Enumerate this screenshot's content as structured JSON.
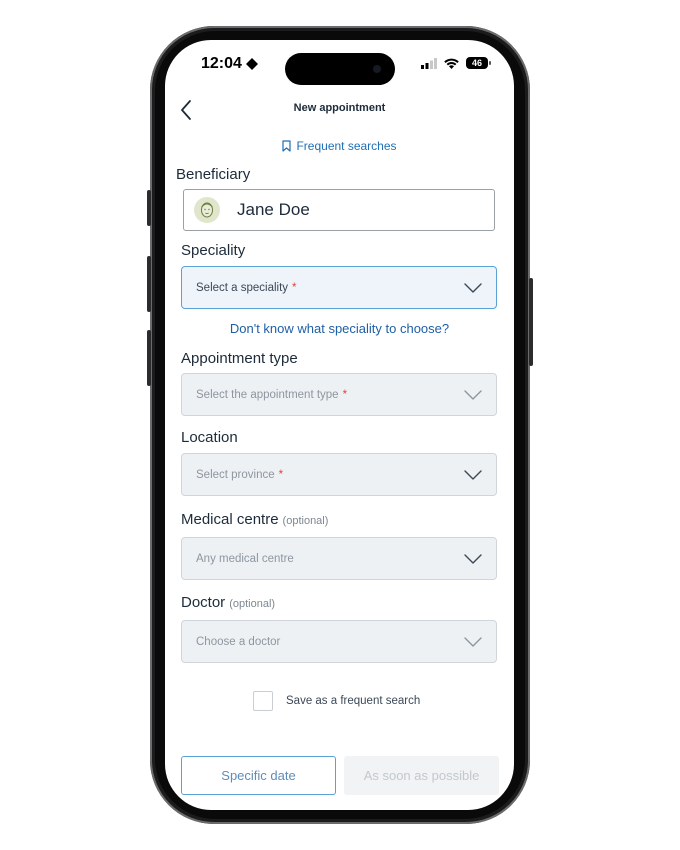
{
  "status_bar": {
    "time": "12:04",
    "battery": "46"
  },
  "header": {
    "title": "New appointment"
  },
  "frequent_searches_link": "Frequent searches",
  "beneficiary": {
    "label": "Beneficiary",
    "name": "Jane Doe"
  },
  "speciality": {
    "label": "Speciality",
    "placeholder": "Select a speciality",
    "required_mark": "*",
    "help_link": "Don't know what speciality to choose?"
  },
  "appointment_type": {
    "label": "Appointment type",
    "placeholder": "Select the appointment type",
    "required_mark": "*"
  },
  "location": {
    "label": "Location",
    "placeholder": "Select province",
    "required_mark": "*"
  },
  "medical_centre": {
    "label": "Medical centre",
    "optional": "(optional)",
    "placeholder": "Any medical centre"
  },
  "doctor": {
    "label": "Doctor",
    "optional": "(optional)",
    "placeholder": "Choose a doctor"
  },
  "save_frequent": {
    "label": "Save as a frequent search",
    "checked": false
  },
  "buttons": {
    "specific_date": "Specific date",
    "asap": "As soon as possible"
  },
  "colors": {
    "accent": "#1f6fb5",
    "required": "#e0433c",
    "active_border": "#5aa2d6",
    "disabled_bg": "#eef1f4"
  }
}
